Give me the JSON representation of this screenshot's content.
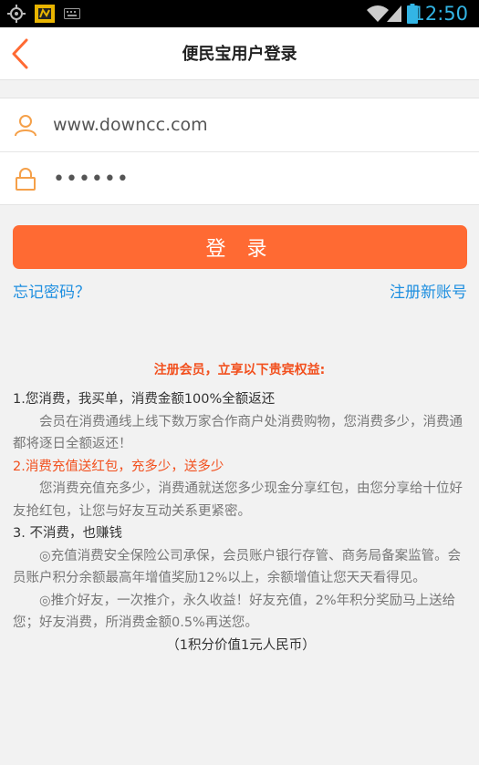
{
  "status_bar": {
    "time": "12:50"
  },
  "header": {
    "title": "便民宝用户登录"
  },
  "form": {
    "username_value": "www.downcc.com",
    "password_value": "••••••"
  },
  "login_button_label": "登 录",
  "links": {
    "forgot": "忘记密码？",
    "register": "注册新账号"
  },
  "benefits": {
    "title": "注册会员，立享以下贵宾权益:",
    "item1_heading": "1.您消费，我买单，消费金额100%全额返还",
    "item1_body": "会员在消费通线上线下数万家合作商户处消费购物，您消费多少，消费通都将逐日全额返还！",
    "item2_number": "2.",
    "item2_heading": "消费充值送红包，充多少，送多少",
    "item2_body": "您消费充值充多少，消费通就送您多少现金分享红包，由您分享给十位好友抢红包，让您与好友互动关系更紧密。",
    "item3_heading": "3. 不消费，也赚钱",
    "item3_body_a": "◎充值消费安全保险公司承保，会员账户银行存管、商务局备案监管。会员账户积分余额最高年增值奖励12%以上，余额增值让您天天看得见。",
    "item3_body_b": "◎推介好友，一次推介，永久收益！好友充值，2%年积分奖励马上送给您；好友消费，所消费金额0.5%再送您。",
    "footnote": "（1积分价值1元人民币）"
  },
  "colors": {
    "accent": "#ff6a33",
    "link": "#1e8fe0",
    "highlight": "#f2501e",
    "status_blue": "#33b5e5"
  }
}
